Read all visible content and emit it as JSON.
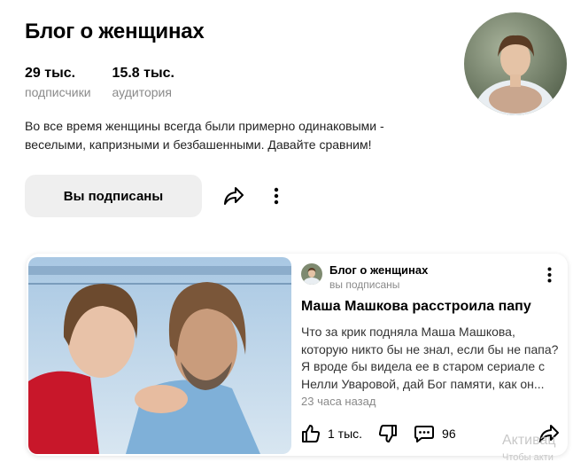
{
  "channel": {
    "title": "Блог о женщинах",
    "stats": [
      {
        "value": "29 тыс.",
        "label": "подписчики"
      },
      {
        "value": "15.8 тыс.",
        "label": "аудитория"
      }
    ],
    "description": "Во все время женщины всегда были примерно одинаковыми - веселыми, капризными и безбашенными. Давайте сравним!",
    "subscribe_label": "Вы подписаны"
  },
  "post": {
    "channel_name": "Блог о женщинах",
    "channel_status": "вы подписаны",
    "title": "Маша Машкова расстроила папу",
    "excerpt": "Что за крик подняла Маша Машкова, которую никто бы не знал, если бы не папа? Я вроде бы видела ее в старом сериале с Нелли Уваровой, дай Бог памяти, как он...",
    "time": "23 часа назад",
    "likes": "1 тыс.",
    "comments": "96"
  },
  "watermark": {
    "line1": "Активац",
    "line2": "Чтобы акти"
  },
  "icons": {
    "share": "share-icon",
    "more": "more-vertical-icon",
    "like": "thumbs-up-icon",
    "dislike": "thumbs-down-icon",
    "comment": "comment-icon"
  }
}
